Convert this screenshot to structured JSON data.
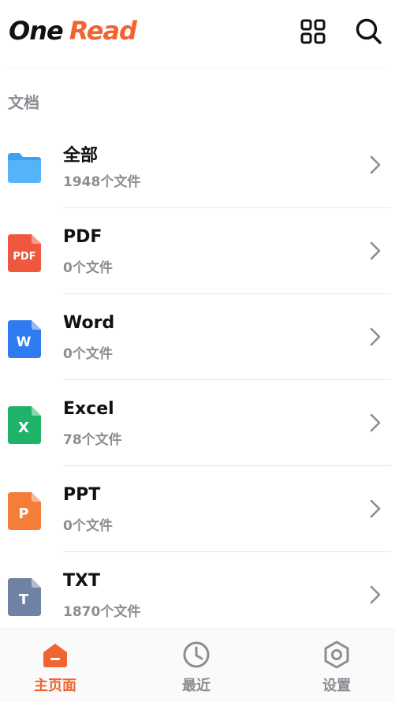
{
  "app": {
    "logo_part1": "One",
    "logo_part2": "Read",
    "accent": "#f06431"
  },
  "header": {
    "grid_icon": "grid-icon",
    "search_icon": "search-icon"
  },
  "section": {
    "title": "文档"
  },
  "files": [
    {
      "name": "全部",
      "count": "1948个文件",
      "icon": "folder-icon",
      "color": "#3ea0f0"
    },
    {
      "name": "PDF",
      "count": "0个文件",
      "icon": "pdf-icon",
      "color": "#f0573f",
      "icon_text": "PDF"
    },
    {
      "name": "Word",
      "count": "0个文件",
      "icon": "word-icon",
      "color": "#2f7cf0",
      "icon_text": "W"
    },
    {
      "name": "Excel",
      "count": "78个文件",
      "icon": "excel-icon",
      "color": "#1fb36a",
      "icon_text": "X"
    },
    {
      "name": "PPT",
      "count": "0个文件",
      "icon": "ppt-icon",
      "color": "#f57d3a",
      "icon_text": "P"
    },
    {
      "name": "TXT",
      "count": "1870个文件",
      "icon": "txt-icon",
      "color": "#6f82a3",
      "icon_text": "T"
    }
  ],
  "nav": {
    "home": "主页面",
    "recent": "最近",
    "settings": "设置",
    "active_color": "#f06431",
    "inactive_color": "#8b8d93"
  }
}
